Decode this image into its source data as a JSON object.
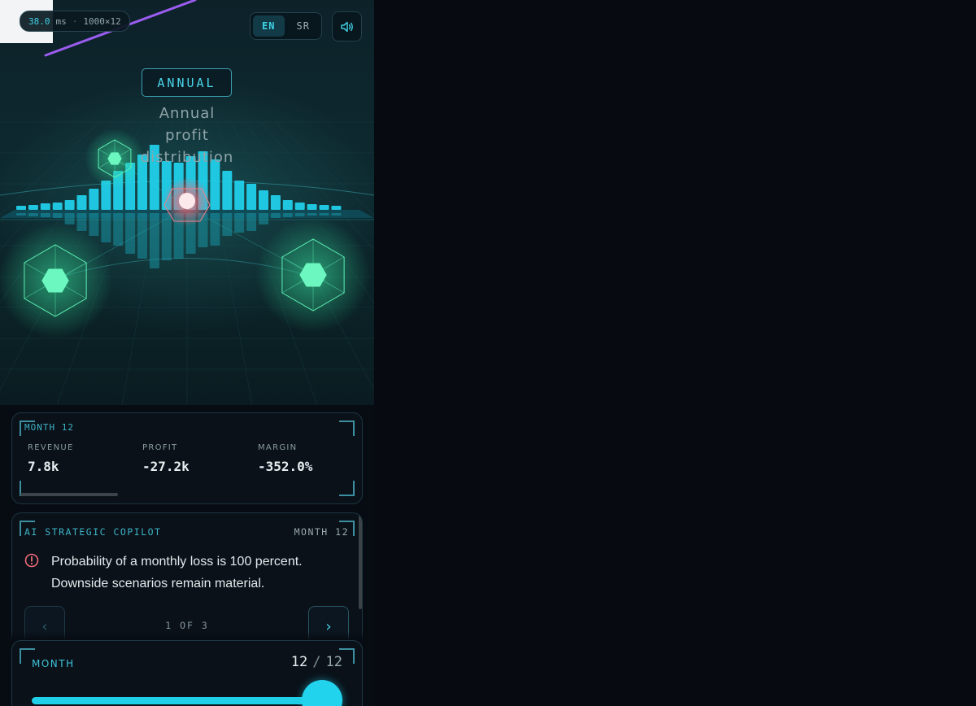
{
  "perf": {
    "frame_time": "38.0",
    "unit": "ms",
    "separator": "·",
    "resolution": "1000×12"
  },
  "language": {
    "options": [
      "EN",
      "SR"
    ],
    "active": "EN"
  },
  "sound": {
    "icon": "speaker-icon"
  },
  "mode": {
    "label": "ANNUAL"
  },
  "scene": {
    "title_lines": [
      "Annual",
      "profit",
      "distribution"
    ]
  },
  "month_summary": {
    "tag": "MONTH 12",
    "metrics": [
      {
        "label": "REVENUE",
        "value": "7.8k"
      },
      {
        "label": "PROFIT",
        "value": "-27.2k"
      },
      {
        "label": "MARGIN",
        "value": "-352.0%"
      }
    ]
  },
  "copilot": {
    "title": "AI STRATEGIC COPILOT",
    "month": "MONTH 12",
    "alert_icon": "alert-circle-icon",
    "message_lines": [
      "Probability of a monthly loss is 100 percent.",
      "Downside scenarios remain material."
    ],
    "pager": "1 OF 3",
    "prev_icon": "chevron-left-icon",
    "next_icon": "chevron-right-icon"
  },
  "month_slider": {
    "label": "MONTH",
    "current": "12",
    "separator": "/",
    "total": "12",
    "level": 1.0
  },
  "colors": {
    "accent": "#22d3ee",
    "teal": "#3db3c7",
    "loss": "#ef6b7a",
    "glow_green": "#39f0a8",
    "violet": "#9b5cf0"
  }
}
